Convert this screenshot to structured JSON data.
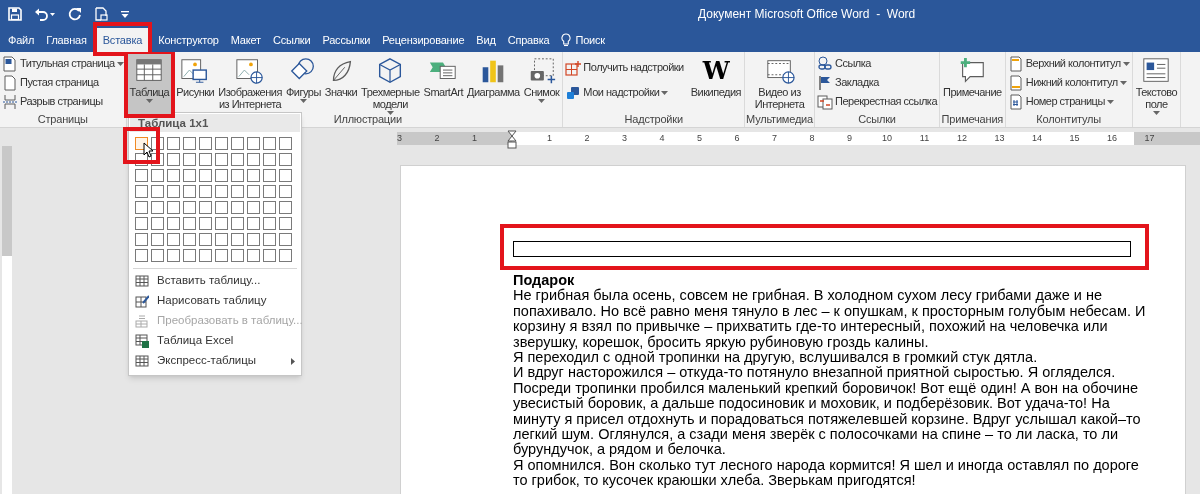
{
  "window": {
    "title": "Документ Microsoft Office Word  -  Word"
  },
  "tabs": [
    {
      "label": "Файл",
      "selected": false,
      "highlighted": false,
      "kind": "tab"
    },
    {
      "label": "Главная",
      "selected": false,
      "highlighted": false,
      "kind": "tab"
    },
    {
      "label": "Вставка",
      "selected": true,
      "highlighted": true,
      "kind": "tab"
    },
    {
      "label": "Конструктор",
      "selected": false,
      "highlighted": false,
      "kind": "tab"
    },
    {
      "label": "Макет",
      "selected": false,
      "highlighted": false,
      "kind": "tab"
    },
    {
      "label": "Ссылки",
      "selected": false,
      "highlighted": false,
      "kind": "tab"
    },
    {
      "label": "Рассылки",
      "selected": false,
      "highlighted": false,
      "kind": "tab"
    },
    {
      "label": "Рецензирование",
      "selected": false,
      "highlighted": false,
      "kind": "tab"
    },
    {
      "label": "Вид",
      "selected": false,
      "highlighted": false,
      "kind": "tab"
    },
    {
      "label": "Справка",
      "selected": false,
      "highlighted": false,
      "kind": "tab"
    },
    {
      "label": "Поиск",
      "selected": false,
      "highlighted": false,
      "kind": "search"
    }
  ],
  "ribbon": {
    "groups": [
      {
        "label": "Страницы",
        "items": [
          {
            "kind": "small",
            "lines": [
              "Титульная страница"
            ],
            "menu_arrow": true
          },
          {
            "kind": "small",
            "lines": [
              "Пустая страница"
            ],
            "menu_arrow": false
          },
          {
            "kind": "small",
            "lines": [
              "Разрыв страницы"
            ],
            "menu_arrow": false
          }
        ]
      },
      {
        "items": [
          {
            "kind": "large",
            "lines": [
              "Таблица"
            ],
            "menu_arrow": true,
            "pressed": true,
            "highlighted": true
          }
        ]
      },
      {
        "label": "Иллюстрации",
        "items": [
          {
            "kind": "large",
            "lines": [
              "Рисунки"
            ],
            "menu_arrow": false
          },
          {
            "kind": "large",
            "lines": [
              "Изображения",
              "из Интернета"
            ],
            "menu_arrow": false
          },
          {
            "kind": "large",
            "lines": [
              "Фигуры"
            ],
            "menu_arrow": true
          },
          {
            "kind": "large",
            "lines": [
              "Значки"
            ],
            "menu_arrow": false
          },
          {
            "kind": "large",
            "lines": [
              "Трехмерные",
              "модели"
            ],
            "menu_arrow": true
          },
          {
            "kind": "large",
            "lines": [
              "SmartArt"
            ],
            "menu_arrow": false
          },
          {
            "kind": "large",
            "lines": [
              "Диаграмма"
            ],
            "menu_arrow": false
          },
          {
            "kind": "large",
            "lines": [
              "Снимок"
            ],
            "menu_arrow": true
          }
        ]
      },
      {
        "label": "Надстройки",
        "items": [
          {
            "kind": "small",
            "lines": [
              "Получить надстройки"
            ],
            "menu_arrow": false
          },
          {
            "kind": "small",
            "lines": [
              "Мои надстройки"
            ],
            "menu_arrow": true
          },
          {
            "kind": "large",
            "lines": [
              "Википедия"
            ],
            "menu_arrow": false,
            "glyph": "W"
          }
        ]
      },
      {
        "label": "Мультимедиа",
        "items": [
          {
            "kind": "large",
            "lines": [
              "Видео из",
              "Интернета"
            ],
            "menu_arrow": false
          }
        ]
      },
      {
        "label": "Ссылки",
        "items": [
          {
            "kind": "small",
            "lines": [
              "Ссылка"
            ],
            "menu_arrow": false
          },
          {
            "kind": "small",
            "lines": [
              "Закладка"
            ],
            "menu_arrow": false
          },
          {
            "kind": "small",
            "lines": [
              "Перекрестная ссылка"
            ],
            "menu_arrow": false
          }
        ]
      },
      {
        "label": "Примечания",
        "items": [
          {
            "kind": "large",
            "lines": [
              "Примечание"
            ],
            "menu_arrow": false
          }
        ]
      },
      {
        "label": "Колонтитулы",
        "items": [
          {
            "kind": "small",
            "lines": [
              "Верхний колонтитул"
            ],
            "menu_arrow": true
          },
          {
            "kind": "small",
            "lines": [
              "Нижний колонтитул"
            ],
            "menu_arrow": true
          },
          {
            "kind": "small",
            "lines": [
              "Номер страницы"
            ],
            "menu_arrow": true
          }
        ]
      },
      {
        "items": [
          {
            "kind": "large",
            "lines": [
              "Текстово",
              "поле"
            ],
            "menu_arrow": true
          }
        ]
      }
    ]
  },
  "table_menu": {
    "header": "Таблица 1x1",
    "grid": [
      [
        true,
        false,
        false,
        false,
        false,
        false,
        false,
        false,
        false,
        false
      ],
      [
        false,
        false,
        false,
        false,
        false,
        false,
        false,
        false,
        false,
        false
      ],
      [
        false,
        false,
        false,
        false,
        false,
        false,
        false,
        false,
        false,
        false
      ],
      [
        false,
        false,
        false,
        false,
        false,
        false,
        false,
        false,
        false,
        false
      ],
      [
        false,
        false,
        false,
        false,
        false,
        false,
        false,
        false,
        false,
        false
      ],
      [
        false,
        false,
        false,
        false,
        false,
        false,
        false,
        false,
        false,
        false
      ],
      [
        false,
        false,
        false,
        false,
        false,
        false,
        false,
        false,
        false,
        false
      ],
      [
        false,
        false,
        false,
        false,
        false,
        false,
        false,
        false,
        false,
        false
      ]
    ],
    "grid_highlighted": true,
    "items": [
      {
        "label": "Вставить таблицу...",
        "disabled": false,
        "submenu": false
      },
      {
        "label": "Нарисовать таблицу",
        "disabled": false,
        "submenu": false
      },
      {
        "label": "Преобразовать в таблицу...",
        "disabled": true,
        "submenu": false
      },
      {
        "label": "Таблица Excel",
        "disabled": false,
        "submenu": false
      },
      {
        "label": "Экспресс-таблицы",
        "disabled": false,
        "submenu": true
      }
    ]
  },
  "ruler": {
    "left_numbers": [
      "3",
      "2",
      "1"
    ],
    "numbers": [
      "1",
      "2",
      "3",
      "4",
      "5",
      "6",
      "7",
      "8",
      "9",
      "10",
      "11",
      "12",
      "13",
      "14",
      "15",
      "16",
      "17"
    ]
  },
  "document": {
    "table_highlighted": true,
    "heading": "Подарок",
    "lines": [
      "Не грибная была осень, совсем не грибная. В холодном сухом лесу грибами даже и не",
      "попахивало. Но всё равно меня тянуло в лес – к опушкам, к просторным голубым небесам. И",
      "корзину я взял по привычке – прихватить где-то интересный, похожий на человечка или",
      "зверушку, корешок, бросить яркую рубиновую гроздь калины.",
      "Я переходил с одной тропинки на другую, вслушивался в громкий стук дятла.",
      "И вдруг насторожился – откуда-то потянуло внезапной приятной сыростью. Я огляделся.",
      "Посреди тропинки пробился маленький крепкий боровичок! Вот ещё один! А вон на обочине",
      "увесистый боровик, а дальше подосиновик и моховик, и подберёзовик. Вот удача-то! На",
      "минуту я присел отдохнуть и порадоваться потяжелевшей корзине. Вдруг услышал какой–то",
      "легкий шум. Оглянулся, а сзади меня зверёк с полосочками на спине – то ли ласка, то ли",
      "бурундучок, а рядом и белочка.",
      "Я опомнился. Вон сколько тут лесного народа кормится! Я шел и иногда оставлял по дороге",
      "то грибок, то кусочек краюшки хлеба. Зверькам пригодятся!"
    ]
  }
}
